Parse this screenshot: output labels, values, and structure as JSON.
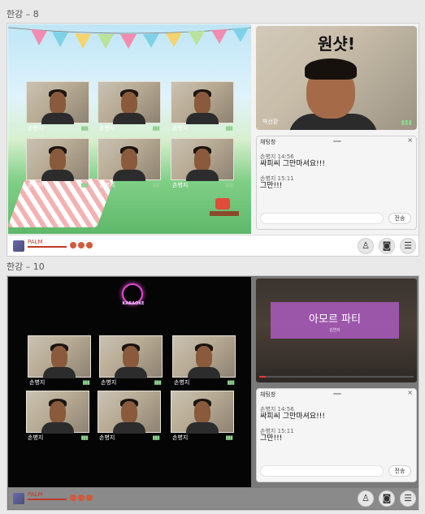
{
  "frames": [
    {
      "label": "한강 – 8",
      "host": {
        "caption": "원샷!",
        "name": "박선환"
      },
      "participants": [
        {
          "name": "손병지"
        },
        {
          "name": "손병지"
        },
        {
          "name": "손병지"
        },
        {
          "name": "손병지"
        },
        {
          "name": "손병지"
        },
        {
          "name": "손병지"
        }
      ],
      "chat": {
        "title": "채팅창",
        "messages": [
          {
            "meta": "손병지 14:56",
            "text": "싸피씨 그만마셔요!!!"
          },
          {
            "meta": "손병지 15:11",
            "text": "그만!!!"
          }
        ],
        "send": "전송"
      },
      "brand": "PALM"
    },
    {
      "label": "한강 – 10",
      "karaoke": "KARAOKE",
      "song": {
        "title": "아모르 파티",
        "artist": "김연자"
      },
      "participants": [
        {
          "name": "손병지"
        },
        {
          "name": "손병지"
        },
        {
          "name": "손병지"
        },
        {
          "name": "손병지"
        },
        {
          "name": "손병지"
        },
        {
          "name": "손병지"
        }
      ],
      "chat": {
        "title": "채팅창",
        "messages": [
          {
            "meta": "손병지 14:56",
            "text": "싸피씨 그만마셔요!!!"
          },
          {
            "meta": "손병지 15:11",
            "text": "그만!!!"
          }
        ],
        "send": "전송"
      },
      "brand": "PALM"
    }
  ],
  "icons": {
    "profile": "person-icon",
    "camera": "camera-icon",
    "chat": "chat-icon"
  },
  "colors": {
    "bunting": [
      "#f28cb0",
      "#7fd1e8",
      "#f6d36b",
      "#b9e39a"
    ],
    "karaoke": "#e24bd1"
  }
}
